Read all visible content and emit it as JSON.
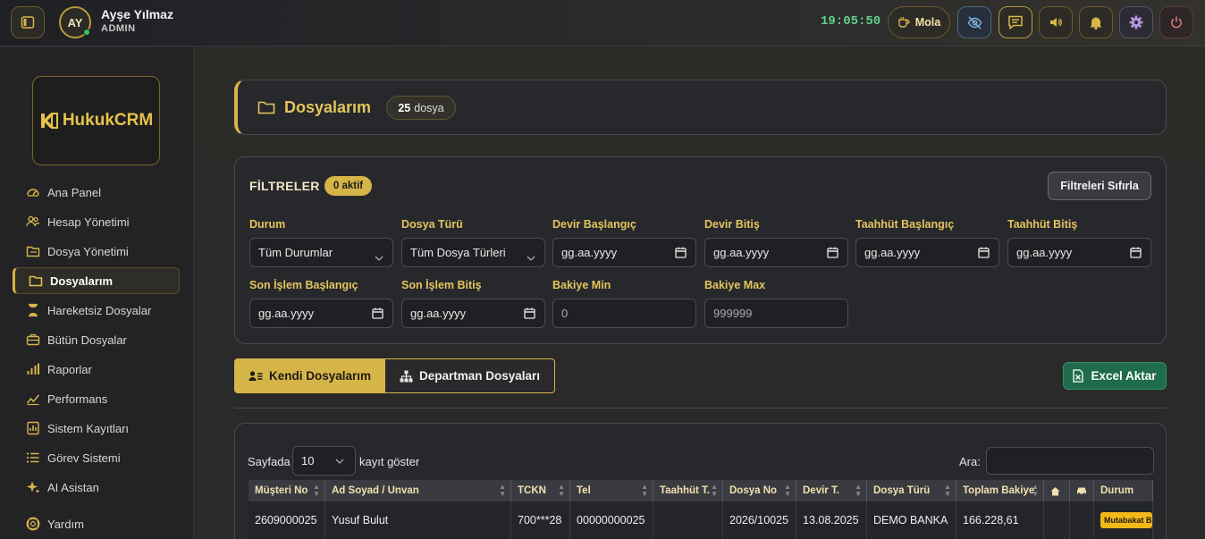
{
  "topbar": {
    "user_initials": "AY",
    "user_name": "Ayşe Yılmaz",
    "user_role": "ADMIN",
    "clock": "19:05:50",
    "break_label": "Mola",
    "accent": "#d6b548"
  },
  "sidebar": {
    "logo_text": "HukukCRM",
    "items": [
      {
        "label": "Ana Panel",
        "icon": "gauge-icon"
      },
      {
        "label": "Hesap Yönetimi",
        "icon": "users-icon"
      },
      {
        "label": "Dosya Yönetimi",
        "icon": "folder-open-icon"
      },
      {
        "label": "Dosyalarım",
        "icon": "folder-icon"
      },
      {
        "label": "Hareketsiz Dosyalar",
        "icon": "hourglass-icon"
      },
      {
        "label": "Bütün Dosyalar",
        "icon": "briefcase-icon"
      },
      {
        "label": "Raporlar",
        "icon": "bar-chart-icon"
      },
      {
        "label": "Performans",
        "icon": "trend-icon"
      },
      {
        "label": "Sistem Kayıtları",
        "icon": "log-icon"
      },
      {
        "label": "Görev Sistemi",
        "icon": "list-icon"
      },
      {
        "label": "AI Asistan",
        "icon": "sparkle-icon"
      },
      {
        "label": "Yardım",
        "icon": "lifebuoy-icon"
      }
    ]
  },
  "page": {
    "title": "Dosyalarım",
    "count_num": "25",
    "count_unit": "dosya"
  },
  "filters": {
    "title": "FİLTRELER",
    "active_badge": "0 aktif",
    "reset_label": "Filtreleri Sıfırla",
    "fields": [
      {
        "label": "Durum",
        "value": "Tüm Durumlar"
      },
      {
        "label": "Dosya Türü",
        "value": "Tüm Dosya Türleri"
      },
      {
        "label": "Devir Başlangıç",
        "value": "gg.aa.yyyy"
      },
      {
        "label": "Devir Bitiş",
        "value": "gg.aa.yyyy"
      },
      {
        "label": "Taahhüt Başlangıç",
        "value": "gg.aa.yyyy"
      },
      {
        "label": "Taahhüt Bitiş",
        "value": "gg.aa.yyyy"
      },
      {
        "label": "Son İşlem Başlangıç",
        "value": "gg.aa.yyyy"
      },
      {
        "label": "Son İşlem Bitiş",
        "value": "gg.aa.yyyy"
      },
      {
        "label": "Bakiye Min",
        "value": "0"
      },
      {
        "label": "Bakiye Max",
        "value": "999999"
      }
    ]
  },
  "tabs": {
    "own": "Kendi Dosyalarım",
    "department": "Departman Dosyaları",
    "excel": "Excel Aktar"
  },
  "table": {
    "show_prefix": "Sayfada",
    "page_size": "10",
    "show_suffix": "kayıt göster",
    "search_label": "Ara:",
    "columns": [
      "Müşteri No",
      "Ad Soyad / Unvan",
      "TCKN",
      "Tel",
      "Taahhüt T.",
      "Dosya No",
      "Devir T.",
      "Dosya Türü",
      "Toplam Bakiye",
      "",
      "",
      "Durum"
    ],
    "rows": [
      [
        "2609000025",
        "Yusuf Bulut",
        "700***28",
        "00000000025",
        "",
        "2026/10025",
        "13.08.2025",
        "DEMO BANKA",
        "166.228,61",
        "",
        "",
        "Mutabakat B"
      ]
    ]
  }
}
